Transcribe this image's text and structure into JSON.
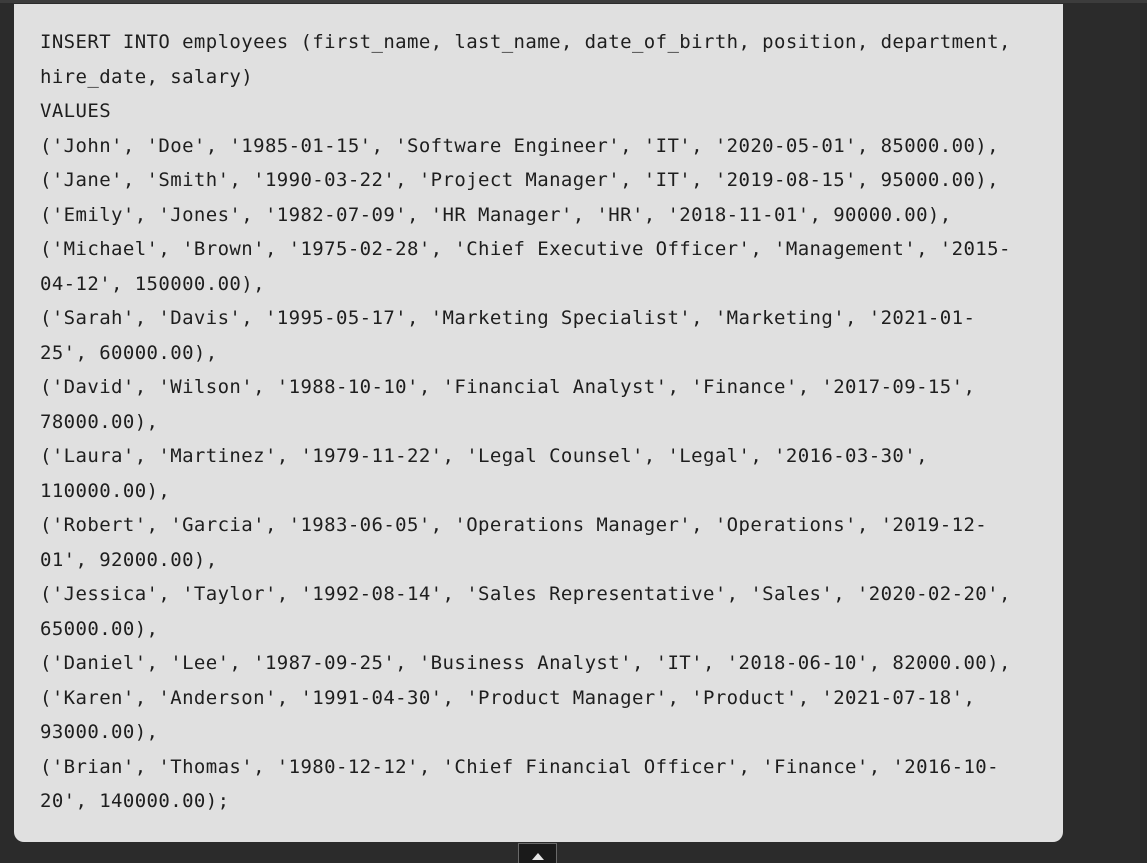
{
  "code": {
    "language": "sql",
    "lines": [
      "INSERT INTO employees (first_name, last_name, date_of_birth, position, department,",
      "hire_date, salary)",
      "VALUES",
      "('John', 'Doe', '1985-01-15', 'Software Engineer', 'IT', '2020-05-01', 85000.00),",
      "('Jane', 'Smith', '1990-03-22', 'Project Manager', 'IT', '2019-08-15', 95000.00),",
      "('Emily', 'Jones', '1982-07-09', 'HR Manager', 'HR', '2018-11-01', 90000.00),",
      "('Michael', 'Brown', '1975-02-28', 'Chief Executive Officer', 'Management', '2015-",
      "04-12', 150000.00),",
      "('Sarah', 'Davis', '1995-05-17', 'Marketing Specialist', 'Marketing', '2021-01-",
      "25', 60000.00),",
      "('David', 'Wilson', '1988-10-10', 'Financial Analyst', 'Finance', '2017-09-15',",
      "78000.00),",
      "('Laura', 'Martinez', '1979-11-22', 'Legal Counsel', 'Legal', '2016-03-30',",
      "110000.00),",
      "('Robert', 'Garcia', '1983-06-05', 'Operations Manager', 'Operations', '2019-12-",
      "01', 92000.00),",
      "('Jessica', 'Taylor', '1992-08-14', 'Sales Representative', 'Sales', '2020-02-20',",
      "65000.00),",
      "('Daniel', 'Lee', '1987-09-25', 'Business Analyst', 'IT', '2018-06-10', 82000.00),",
      "('Karen', 'Anderson', '1991-04-30', 'Product Manager', 'Product', '2021-07-18',",
      "93000.00),",
      "('Brian', 'Thomas', '1980-12-12', 'Chief Financial Officer', 'Finance', '2016-10-",
      "20', 140000.00);"
    ]
  },
  "scroll_button": {
    "icon": "chevron-up-icon"
  },
  "colors": {
    "page_background": "#2b2b2b",
    "code_background": "#e0e0e0",
    "code_text": "#1e1e1e"
  }
}
